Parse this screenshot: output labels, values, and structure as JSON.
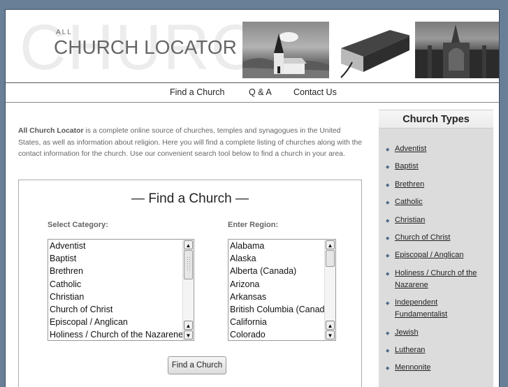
{
  "header": {
    "watermark": "CHURCH",
    "logo_small": "ALL",
    "logo_main": "CHURCH LOCATOR",
    "photos": [
      "church-photo",
      "bible-photo",
      "cathedral-photo"
    ]
  },
  "nav": {
    "items": [
      {
        "label": "Find a Church"
      },
      {
        "label": "Q & A"
      },
      {
        "label": "Contact Us"
      }
    ]
  },
  "intro": {
    "brand": "All Church Locator",
    "text": " is a complete online source of churches, temples and synagogues in the United States, as well as information about religion. Here you will find a complete listing of churches along with the contact information for the church. Use our convenient search tool below to find a church in your area."
  },
  "finder": {
    "title": "— Find a Church —",
    "category_label": "Select Category:",
    "region_label": "Enter Region:",
    "categories": [
      "Adventist",
      "Baptist",
      "Brethren",
      "Catholic",
      "Christian",
      "Church of Christ",
      "Episcopal / Anglican",
      "Holiness / Church of the Nazarene"
    ],
    "regions": [
      "Alabama",
      "Alaska",
      "Alberta (Canada)",
      "Arizona",
      "Arkansas",
      "British Columbia (Canada)",
      "California",
      "Colorado"
    ],
    "button_label": "Find a Church"
  },
  "sidebar": {
    "title": "Church Types",
    "items": [
      {
        "label": "Adventist"
      },
      {
        "label": "Baptist"
      },
      {
        "label": "Brethren"
      },
      {
        "label": "Catholic"
      },
      {
        "label": "Christian"
      },
      {
        "label": "Church of Christ"
      },
      {
        "label": "Episcopal / Anglican"
      },
      {
        "label": "Holiness / Church of the Nazarene"
      },
      {
        "label": "Independent Fundamentalist"
      },
      {
        "label": "Jewish"
      },
      {
        "label": "Lutheran"
      },
      {
        "label": "Mennonite"
      }
    ]
  },
  "colors": {
    "background": "#687f97",
    "bullet": "#4e6a8a",
    "sidebar_bg": "#dcdcdc"
  }
}
